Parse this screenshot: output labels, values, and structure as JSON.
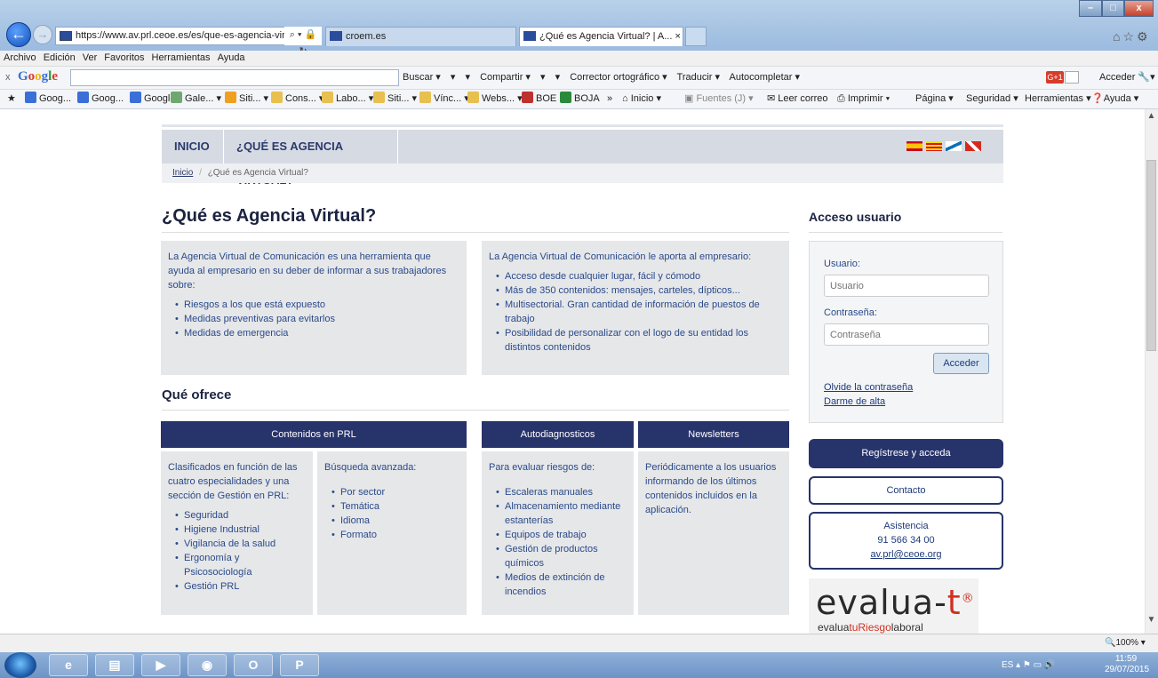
{
  "browser": {
    "address": "https://www.av.prl.ceoe.es/es/que-es-agencia-virtual/",
    "tabs": [
      {
        "label": "croem.es"
      },
      {
        "label": "¿Qué es Agencia Virtual? | A..."
      }
    ],
    "close_tab": "×",
    "window_buttons": {
      "minimize": "–",
      "maximize": "□",
      "close": "x"
    }
  },
  "menubar": {
    "items": [
      "Archivo",
      "Edición",
      "Ver",
      "Favoritos",
      "Herramientas",
      "Ayuda"
    ]
  },
  "google_toolbar": {
    "close": "x",
    "logo": "Google",
    "tools": [
      "Buscar ▾",
      "▾",
      "▾",
      "Compartir ▾",
      "▾",
      "▾",
      "Corrector ortográfico ▾",
      "Traducir ▾",
      "Autocompletar ▾"
    ],
    "gplus": "G+1",
    "signin": "Acceder"
  },
  "favorites": [
    {
      "label": "Goog...",
      "color": "#3a6fd8"
    },
    {
      "label": "Goog...",
      "color": "#3a6fd8"
    },
    {
      "label": "Google",
      "color": "#3a6fd8"
    },
    {
      "label": "Gale... ▾",
      "color": "#6fa86f"
    },
    {
      "label": "Siti... ▾",
      "color": "#f0a020"
    },
    {
      "label": "Cons... ▾",
      "color": "#e8c050"
    },
    {
      "label": "Labo... ▾",
      "color": "#e8c050"
    },
    {
      "label": "Siti... ▾",
      "color": "#e8c050"
    },
    {
      "label": "Vínc... ▾",
      "color": "#e8c050"
    },
    {
      "label": "Webs... ▾",
      "color": "#e8c050"
    },
    {
      "label": "BOE",
      "color": "#c03030"
    },
    {
      "label": "BOJA",
      "color": "#2a8a3a"
    }
  ],
  "command_bar": [
    "Inicio ▾",
    "Fuentes (J) ▾",
    "Leer correo",
    "Imprimir ▾",
    "Página ▾",
    "Seguridad ▾",
    "Herramientas ▾",
    "Ayuda ▾"
  ],
  "page": {
    "nav": [
      "INICIO",
      "¿QUÉ ES AGENCIA VIRTUAL?"
    ],
    "breadcrumb": {
      "home": "Inicio",
      "sep": "/",
      "current": "¿Qué es Agencia Virtual?"
    },
    "title": "¿Qué es Agencia Virtual?",
    "box1": {
      "intro": "La Agencia Virtual de Comunicación es una herramienta que ayuda al empresario en su deber de informar a sus trabajadores sobre:",
      "items": [
        "Riesgos a los que está expuesto",
        "Medidas preventivas para evitarlos",
        "Medidas de emergencia"
      ]
    },
    "box2": {
      "intro": "La Agencia Virtual de Comunicación le aporta al empresario:",
      "items": [
        "Acceso desde cualquier lugar, fácil y cómodo",
        "Más de 350 contenidos: mensajes, carteles, dípticos...",
        "Multisectorial. Gran cantidad de información de puestos de trabajo",
        "Posibilidad de personalizar con el logo de su entidad los distintos contenidos"
      ]
    },
    "offers_title": "Qué ofrece",
    "headers": [
      "Contenidos en PRL",
      "Autodiagnosticos",
      "Newsletters"
    ],
    "col1": {
      "intro": "Clasificados en función de las cuatro especialidades y una sección de Gestión en PRL:",
      "items": [
        "Seguridad",
        "Higiene Industrial",
        "Vigilancia de la salud",
        "Ergonomía y Psicosociología",
        "Gestión PRL"
      ]
    },
    "col2": {
      "intro": "Búsqueda avanzada:",
      "items": [
        "Por sector",
        "Temática",
        "Idioma",
        "Formato"
      ]
    },
    "col3": {
      "intro": "Para evaluar riesgos de:",
      "items": [
        "Escaleras manuales",
        "Almacenamiento mediante estanterías",
        "Equipos de trabajo",
        "Gestión de productos químicos",
        "Medios de extinción de incendios"
      ]
    },
    "col4": {
      "intro": "Periódicamente a los usuarios informando de los últimos contenidos incluidos en la aplicación."
    }
  },
  "login": {
    "title": "Acceso usuario",
    "user_label": "Usuario:",
    "user_placeholder": "Usuario",
    "pass_label": "Contraseña:",
    "pass_placeholder": "Contraseña",
    "submit": "Acceder",
    "forgot": "Olvide la contraseña",
    "register_link": "Darme de alta"
  },
  "sidebar": {
    "register": "Regístrese y acceda",
    "contact": "Contacto",
    "assist_title": "Asistencia",
    "assist_phone": "91 566 34 00",
    "assist_email": "av.prl@ceoe.org",
    "logo_main": "evalua-",
    "logo_t": "t",
    "logo_reg": "®",
    "logo_sub_a": "evalua",
    "logo_sub_b": "tu",
    "logo_sub_c": "Riesgo",
    "logo_sub_d": "laboral"
  },
  "status": {
    "zoom": "100%  ▾"
  },
  "taskbar": {
    "lang": "ES",
    "time": "11:59",
    "date": "29/07/2015"
  }
}
